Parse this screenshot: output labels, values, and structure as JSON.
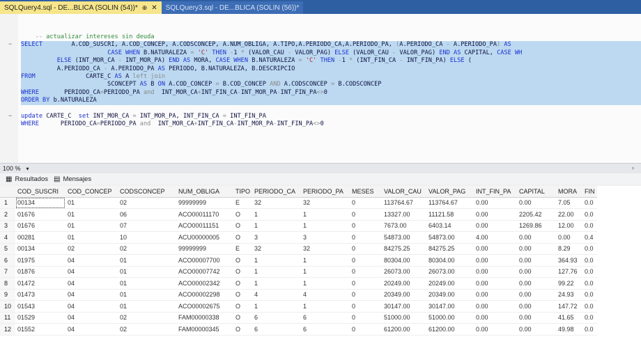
{
  "tabs": [
    {
      "label": "SQLQuery4.sql - DE...BLICA (SOLIN (54))*",
      "pin": "⊕",
      "close": "✕",
      "active": true
    },
    {
      "label": "SQLQuery3.sql - DE...BLICA (SOLIN (56))*",
      "active": false
    }
  ],
  "editor": {
    "lines": [
      {
        "selected": false,
        "fold": "",
        "tokens": [
          {
            "c": "gr",
            "t": "    -- "
          },
          {
            "c": "cm",
            "t": "actualizar intereses sin deuda"
          }
        ]
      },
      {
        "selected": true,
        "fold": "−",
        "tokens": [
          {
            "c": "kw",
            "t": "SELECT"
          },
          {
            "c": "tx",
            "t": "        A.COD_SUSCRI, A.COD_CONCEP, A.CODSCONCEP, A.NUM_OBLIGA, A.TIPO,A.PERIODO_CA,A.PERIODO_PA, "
          },
          {
            "c": "gr",
            "t": "("
          },
          {
            "c": "tx",
            "t": "A.PERIODO_CA "
          },
          {
            "c": "gr",
            "t": "-"
          },
          {
            "c": "tx",
            "t": " A.PERIODO_PA"
          },
          {
            "c": "gr",
            "t": ")"
          },
          {
            "c": "kw",
            "t": " AS"
          }
        ]
      },
      {
        "selected": true,
        "fold": "",
        "tokens": [
          {
            "c": "tx",
            "t": "                        "
          },
          {
            "c": "kw",
            "t": "CASE WHEN"
          },
          {
            "c": "tx",
            "t": " B.NATURALEZA "
          },
          {
            "c": "gr",
            "t": "="
          },
          {
            "c": "str",
            "t": " 'C'"
          },
          {
            "c": "kw",
            "t": " THEN"
          },
          {
            "c": "gr",
            "t": " -"
          },
          {
            "c": "tx",
            "t": "1 "
          },
          {
            "c": "gr",
            "t": "*"
          },
          {
            "c": "tx",
            "t": " (VALOR_CAU "
          },
          {
            "c": "gr",
            "t": "-"
          },
          {
            "c": "tx",
            "t": " VALOR_PAG) "
          },
          {
            "c": "kw",
            "t": "ELSE"
          },
          {
            "c": "tx",
            "t": " (VALOR_CAU "
          },
          {
            "c": "gr",
            "t": "-"
          },
          {
            "c": "tx",
            "t": " VALOR_PAG) "
          },
          {
            "c": "kw",
            "t": "END AS"
          },
          {
            "c": "tx",
            "t": " CAPITAL, "
          },
          {
            "c": "kw",
            "t": "CASE WH"
          }
        ]
      },
      {
        "selected": true,
        "fold": "",
        "tokens": [
          {
            "c": "tx",
            "t": "          "
          },
          {
            "c": "kw",
            "t": "ELSE"
          },
          {
            "c": "tx",
            "t": " (INT_MOR_CA "
          },
          {
            "c": "gr",
            "t": "-"
          },
          {
            "c": "tx",
            "t": " INT_MOR_PA) "
          },
          {
            "c": "kw",
            "t": "END AS"
          },
          {
            "c": "tx",
            "t": " MORA, "
          },
          {
            "c": "kw",
            "t": "CASE WHEN"
          },
          {
            "c": "tx",
            "t": " B.NATURALEZA "
          },
          {
            "c": "gr",
            "t": "="
          },
          {
            "c": "str",
            "t": " 'C'"
          },
          {
            "c": "kw",
            "t": " THEN"
          },
          {
            "c": "gr",
            "t": " -"
          },
          {
            "c": "tx",
            "t": "1 "
          },
          {
            "c": "gr",
            "t": "*"
          },
          {
            "c": "tx",
            "t": " (INT_FIN_CA "
          },
          {
            "c": "gr",
            "t": "-"
          },
          {
            "c": "tx",
            "t": " INT_FIN_PA) "
          },
          {
            "c": "kw",
            "t": "ELSE"
          },
          {
            "c": "tx",
            "t": " ("
          }
        ]
      },
      {
        "selected": true,
        "fold": "",
        "tokens": [
          {
            "c": "tx",
            "t": "          A.PERIODO_CA "
          },
          {
            "c": "gr",
            "t": "-"
          },
          {
            "c": "tx",
            "t": " A.PERIODO_PA "
          },
          {
            "c": "kw",
            "t": "AS"
          },
          {
            "c": "tx",
            "t": " PERIODO, B.NATURALEZA, B.DESCRIPCIO"
          }
        ]
      },
      {
        "selected": true,
        "fold": "",
        "tokens": [
          {
            "c": "kw",
            "t": "FROM"
          },
          {
            "c": "tx",
            "t": "              CARTE_C "
          },
          {
            "c": "kw",
            "t": "AS"
          },
          {
            "c": "tx",
            "t": " A "
          },
          {
            "c": "gr",
            "t": "left join"
          }
        ]
      },
      {
        "selected": true,
        "fold": "",
        "tokens": [
          {
            "c": "tx",
            "t": "                        SCONCEPT "
          },
          {
            "c": "kw",
            "t": "AS"
          },
          {
            "c": "tx",
            "t": " B "
          },
          {
            "c": "kw",
            "t": "ON"
          },
          {
            "c": "tx",
            "t": " A.COD_CONCEP "
          },
          {
            "c": "gr",
            "t": "="
          },
          {
            "c": "tx",
            "t": " B.COD_CONCEP "
          },
          {
            "c": "gr",
            "t": "AND"
          },
          {
            "c": "tx",
            "t": " A.CODSCONCEP "
          },
          {
            "c": "gr",
            "t": "="
          },
          {
            "c": "tx",
            "t": " B.CODSCONCEP"
          }
        ]
      },
      {
        "selected": true,
        "fold": "",
        "tokens": [
          {
            "c": "kw",
            "t": "WHERE"
          },
          {
            "c": "tx",
            "t": "       PERIODO_CA"
          },
          {
            "c": "gr",
            "t": "="
          },
          {
            "c": "tx",
            "t": "PERIODO_PA "
          },
          {
            "c": "gr",
            "t": "and"
          },
          {
            "c": "tx",
            "t": "  INT_MOR_CA"
          },
          {
            "c": "gr",
            "t": "+"
          },
          {
            "c": "tx",
            "t": "INT_FIN_CA"
          },
          {
            "c": "gr",
            "t": "-"
          },
          {
            "c": "tx",
            "t": "INT_MOR_PA"
          },
          {
            "c": "gr",
            "t": "-"
          },
          {
            "c": "tx",
            "t": "INT_FIN_PA"
          },
          {
            "c": "gr",
            "t": "<>"
          },
          {
            "c": "tx",
            "t": "0"
          }
        ]
      },
      {
        "selected": true,
        "fold": "",
        "tokens": [
          {
            "c": "kw",
            "t": "ORDER BY"
          },
          {
            "c": "tx",
            "t": " b.NATURALEZA"
          }
        ]
      },
      {
        "selected": false,
        "fold": "",
        "tokens": [
          {
            "c": "tx",
            "t": ""
          }
        ]
      },
      {
        "selected": false,
        "fold": "−",
        "tokens": [
          {
            "c": "kw",
            "t": "update"
          },
          {
            "c": "tx",
            "t": " CARTE_C  "
          },
          {
            "c": "kw",
            "t": "set"
          },
          {
            "c": "tx",
            "t": " INT_MOR_CA "
          },
          {
            "c": "gr",
            "t": "="
          },
          {
            "c": "tx",
            "t": " INT_MOR_PA, INT_FIN_CA "
          },
          {
            "c": "gr",
            "t": "="
          },
          {
            "c": "tx",
            "t": " INT_FIN_PA"
          }
        ]
      },
      {
        "selected": false,
        "fold": "",
        "tokens": [
          {
            "c": "kw",
            "t": "WHERE"
          },
          {
            "c": "tx",
            "t": "      PERIODO_CA"
          },
          {
            "c": "gr",
            "t": "="
          },
          {
            "c": "tx",
            "t": "PERIODO_PA "
          },
          {
            "c": "gr",
            "t": "and"
          },
          {
            "c": "tx",
            "t": "  INT_MOR_CA"
          },
          {
            "c": "gr",
            "t": "+"
          },
          {
            "c": "tx",
            "t": "INT_FIN_CA"
          },
          {
            "c": "gr",
            "t": "-"
          },
          {
            "c": "tx",
            "t": "INT_MOR_PA"
          },
          {
            "c": "gr",
            "t": "-"
          },
          {
            "c": "tx",
            "t": "INT_FIN_PA"
          },
          {
            "c": "gr",
            "t": "<>"
          },
          {
            "c": "tx",
            "t": "0"
          }
        ]
      }
    ]
  },
  "zoombar": {
    "zoom": "100 %",
    "dropdown": "▾",
    "scroll_arrow": "›"
  },
  "results_tabs": [
    {
      "label": "Resultados",
      "icon": "▦"
    },
    {
      "label": "Mensajes",
      "icon": "▤"
    }
  ],
  "grid": {
    "columns": [
      "",
      "COD_SUSCRI",
      "COD_CONCEP",
      "CODSCONCEP",
      "NUM_OBLIGA",
      "TIPO",
      "PERIODO_CA",
      "PERIODO_PA",
      "MESES",
      "VALOR_CAU",
      "VALOR_PAG",
      "INT_FIN_PA",
      "CAPITAL",
      "MORA",
      "FIN"
    ],
    "rows": [
      [
        "1",
        "00134",
        "01",
        "02",
        "99999999",
        "E",
        "32",
        "32",
        "0",
        "113764.67",
        "113764.67",
        "0.00",
        "0.00",
        "7.05",
        "0.0"
      ],
      [
        "2",
        "01676",
        "01",
        "06",
        "ACO00011170",
        "O",
        "1",
        "1",
        "0",
        "13327.00",
        "11121.58",
        "0.00",
        "2205.42",
        "22.00",
        "0.0"
      ],
      [
        "3",
        "01676",
        "01",
        "07",
        "ACO00011151",
        "O",
        "1",
        "1",
        "0",
        "7673.00",
        "6403.14",
        "0.00",
        "1269.86",
        "12.00",
        "0.0"
      ],
      [
        "4",
        "00281",
        "01",
        "10",
        "ACU00000005",
        "O",
        "3",
        "3",
        "0",
        "54873.00",
        "54873.00",
        "4.00",
        "0.00",
        "0.00",
        "0.4"
      ],
      [
        "5",
        "00134",
        "02",
        "02",
        "99999999",
        "E",
        "32",
        "32",
        "0",
        "84275.25",
        "84275.25",
        "0.00",
        "0.00",
        "8.29",
        "0.0"
      ],
      [
        "6",
        "01975",
        "04",
        "01",
        "ACO00007700",
        "O",
        "1",
        "1",
        "0",
        "80304.00",
        "80304.00",
        "0.00",
        "0.00",
        "364.93",
        "0.0"
      ],
      [
        "7",
        "01876",
        "04",
        "01",
        "ACO00007742",
        "O",
        "1",
        "1",
        "0",
        "26073.00",
        "26073.00",
        "0.00",
        "0.00",
        "127.76",
        "0.0"
      ],
      [
        "8",
        "01472",
        "04",
        "01",
        "ACO00002342",
        "O",
        "1",
        "1",
        "0",
        "20249.00",
        "20249.00",
        "0.00",
        "0.00",
        "99.22",
        "0.0"
      ],
      [
        "9",
        "01473",
        "04",
        "01",
        "ACO00002298",
        "O",
        "4",
        "4",
        "0",
        "20349.00",
        "20349.00",
        "0.00",
        "0.00",
        "24.93",
        "0.0"
      ],
      [
        "10",
        "01543",
        "04",
        "01",
        "ACO00002675",
        "O",
        "1",
        "1",
        "0",
        "30147.00",
        "30147.00",
        "0.00",
        "0.00",
        "147.72",
        "0.0"
      ],
      [
        "11",
        "01529",
        "04",
        "02",
        "FAM00000338",
        "O",
        "6",
        "6",
        "0",
        "51000.00",
        "51000.00",
        "0.00",
        "0.00",
        "41.65",
        "0.0"
      ],
      [
        "12",
        "01552",
        "04",
        "02",
        "FAM00000345",
        "O",
        "6",
        "6",
        "0",
        "61200.00",
        "61200.00",
        "0.00",
        "0.00",
        "49.98",
        "0.0"
      ]
    ]
  }
}
